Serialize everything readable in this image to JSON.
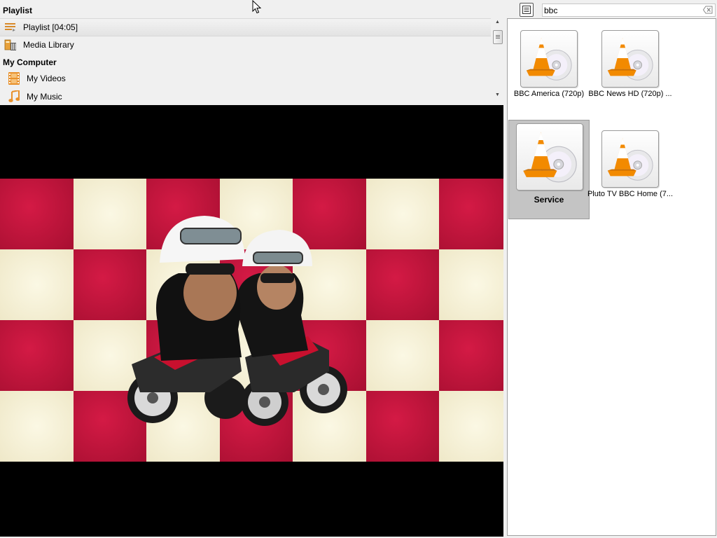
{
  "sidebar": {
    "playlist_header": "Playlist",
    "computer_header": "My Computer",
    "items": [
      {
        "label": "Playlist [04:05]",
        "icon": "playlist-icon"
      },
      {
        "label": "Media Library",
        "icon": "media-library-icon"
      },
      {
        "label": "My Videos",
        "icon": "video-film-icon"
      },
      {
        "label": "My Music",
        "icon": "music-note-icon"
      }
    ]
  },
  "search": {
    "value": "bbc",
    "placeholder": ""
  },
  "results": [
    {
      "label": "BBC America (720p)",
      "icon": "vlc-cone-disc-icon"
    },
    {
      "label": "BBC News HD (720p) ...",
      "icon": "vlc-cone-disc-icon"
    },
    {
      "label": "Service",
      "icon": "vlc-cone-disc-icon",
      "selected": true
    },
    {
      "label": "Pluto TV BBC Home (7...",
      "icon": "vlc-cone-disc-icon"
    }
  ],
  "colors": {
    "checker_red": "#c3133b",
    "checker_cream": "#f7f2d8",
    "vlc_orange": "#f28a00",
    "selection_gray": "#c4c4c4"
  }
}
